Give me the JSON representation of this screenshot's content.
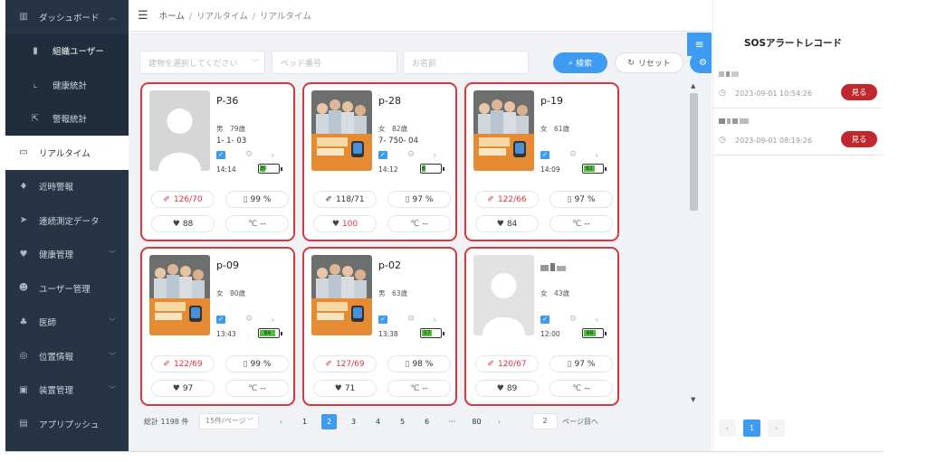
{
  "sidebar": {
    "items": [
      {
        "label": "ダッシュボード",
        "icon": "bar-chart-icon",
        "chev": "︿",
        "type": "parent"
      },
      {
        "label": "組織ユーザー",
        "icon": "org-chart-icon",
        "type": "sub-strong"
      },
      {
        "label": "健康統計",
        "icon": "line-chart-icon",
        "type": "sub"
      },
      {
        "label": "警報統計",
        "icon": "export-icon",
        "type": "sub"
      },
      {
        "label": "リアルタイム",
        "icon": "monitor-icon",
        "type": "active"
      },
      {
        "label": "近時警報",
        "icon": "bell-icon",
        "type": "item"
      },
      {
        "label": "連続測定データ",
        "icon": "send-icon",
        "type": "item"
      },
      {
        "label": "健康管理",
        "icon": "heart-icon",
        "chev": "﹀",
        "type": "item"
      },
      {
        "label": "ユーザー管理",
        "icon": "users-icon",
        "type": "item"
      },
      {
        "label": "医師",
        "icon": "doctor-icon",
        "chev": "﹀",
        "type": "item"
      },
      {
        "label": "位置情報",
        "icon": "location-icon",
        "chev": "﹀",
        "type": "item"
      },
      {
        "label": "装置管理",
        "icon": "device-icon",
        "chev": "﹀",
        "type": "item"
      },
      {
        "label": "アプリプッシュ",
        "icon": "push-icon",
        "type": "item"
      }
    ]
  },
  "breadcrumb": {
    "home": "ホーム",
    "sep": "/",
    "level1": "リアルタイム",
    "level2": "リアルタイム"
  },
  "filters": {
    "building_placeholder": "建物を選択してください",
    "bed_placeholder": "ベッド番号",
    "name_placeholder": "お名前",
    "search_label": "検索",
    "reset_label": "リセット"
  },
  "cards": [
    {
      "name": "P-36",
      "photo": "placeholder-gray",
      "info1": "男　79歳",
      "info2": "1- 1- 03",
      "time": "14:14",
      "battery": "30",
      "bp": "126/70",
      "bp_red": true,
      "spo2": "99 %",
      "hr": "88",
      "hr_red": false,
      "temp": "--"
    },
    {
      "name": "p-28",
      "photo": "group",
      "info1": "女　82歳",
      "info2": "7- 750- 04",
      "time": "14:12",
      "battery": "6",
      "bp": "118/71",
      "bp_red": false,
      "spo2": "97 %",
      "hr": "100",
      "hr_red": true,
      "temp": "--"
    },
    {
      "name": "p-19",
      "photo": "group",
      "info1": "女　61歳",
      "info2": "",
      "time": "14:09",
      "battery": "61",
      "bp": "122/66",
      "bp_red": true,
      "spo2": "97 %",
      "hr": "84",
      "hr_red": false,
      "temp": "--"
    },
    {
      "name": "p-09",
      "photo": "group",
      "info1": "女　80歳",
      "info2": "",
      "time": "13:43",
      "battery": "84",
      "bp": "122/69",
      "bp_red": true,
      "spo2": "99 %",
      "hr": "97",
      "hr_red": false,
      "temp": "--"
    },
    {
      "name": "p-02",
      "photo": "group",
      "info1": "男　63歳",
      "info2": "",
      "time": "13:38",
      "battery": "57",
      "bp": "127/69",
      "bp_red": true,
      "spo2": "98 %",
      "hr": "71",
      "hr_red": false,
      "temp": "--"
    },
    {
      "name": "",
      "photo": "placeholder-light",
      "info1": "女　43歳",
      "info2": "",
      "time": "12:00",
      "battery": "66",
      "bp": "120/67",
      "bp_red": true,
      "spo2": "97 %",
      "hr": "89",
      "hr_red": false,
      "temp": "--"
    }
  ],
  "units": {
    "temp": "℃"
  },
  "pagination": {
    "total": "総計 1198 件",
    "page_size": "15件/ページ",
    "pages": [
      "1",
      "2",
      "3",
      "4",
      "5",
      "6",
      "···",
      "80"
    ],
    "active_page": "2",
    "prev": "‹",
    "next": "›",
    "goto_value": "2",
    "goto_label": "ページ目へ"
  },
  "sos": {
    "title": "SOSアラートレコード",
    "records": [
      {
        "time": "2023-09-01 10:54:26",
        "view": "見る"
      },
      {
        "time": "2023-09-01 08:19:26",
        "view": "見る"
      }
    ],
    "page": "1",
    "prev": "‹",
    "next": "›"
  },
  "colors": {
    "sidebar": "#263445",
    "accent": "#3e9bf2",
    "card_border": "#d9363e",
    "view_button": "#c0282d",
    "battery": "#4cc235"
  }
}
